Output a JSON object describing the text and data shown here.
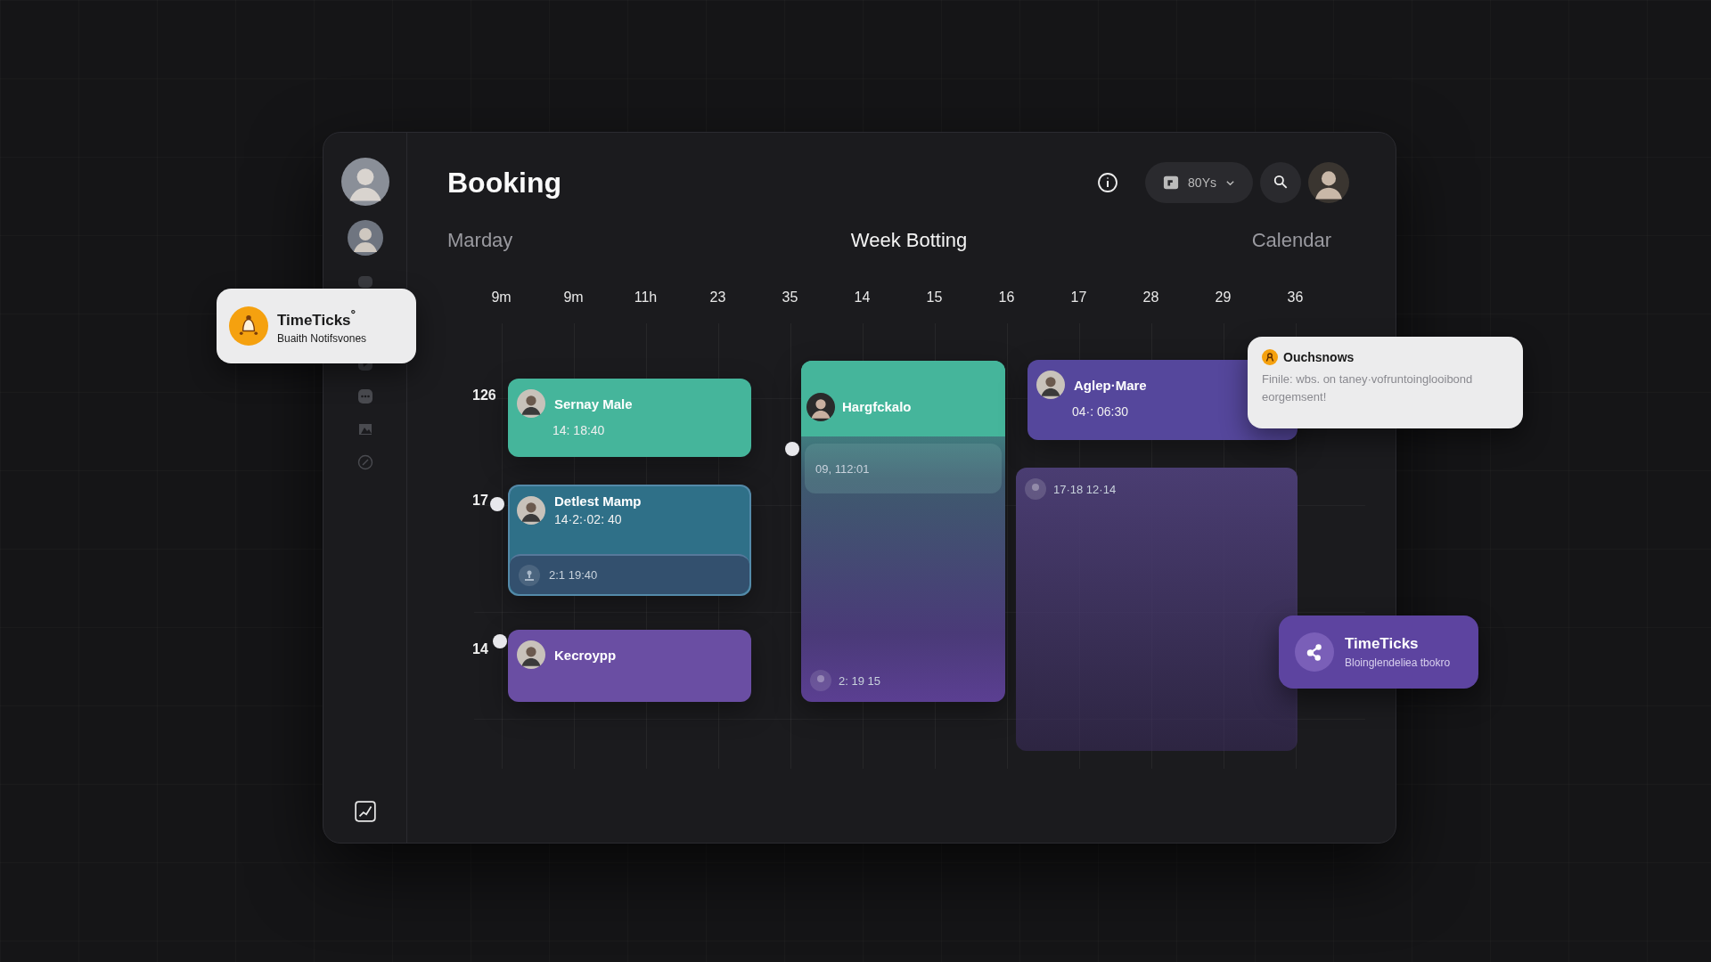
{
  "header": {
    "title": "Booking",
    "dropdown": {
      "value": "80Ys"
    }
  },
  "view_bar": {
    "left": "Marday",
    "center": "Week Botting",
    "right": "Calendar"
  },
  "hours": [
    "9m",
    "9m",
    "11h",
    "23",
    "35",
    "14",
    "15",
    "16",
    "17",
    "28",
    "29",
    "36"
  ],
  "rows": [
    "126",
    "17",
    "14"
  ],
  "events": [
    {
      "kind": "card",
      "title": "Sernay Male",
      "time": "14: 18:40",
      "color": "#45b59b"
    },
    {
      "kind": "split",
      "title": "Detlest Mamp",
      "time": "14·2:·02: 40",
      "detail": "2:1 19:40",
      "color": "#2f7088"
    },
    {
      "kind": "card",
      "title": "Kecroypp",
      "color": "#6a4ea3"
    },
    {
      "kind": "column",
      "title": "Hargfckalo",
      "detail": "09, 112:01",
      "footer": "2: 19 15",
      "color": "#45b59b"
    },
    {
      "kind": "card",
      "title": "Aglep·Mare",
      "time": "04·: 06:30",
      "color": "#55479c"
    },
    {
      "kind": "block",
      "time": "17·18 12·14",
      "color": "#4a3d72"
    }
  ],
  "notifications": [
    {
      "kind": "app",
      "title": "TimeTicks$^{°}$",
      "body": "Buaith Notifsvones"
    },
    {
      "kind": "banner",
      "title": "Ouchsnows",
      "body": "Finile: wbs. on taney·vofruntoinglooibond eorgemsent!"
    },
    {
      "kind": "accent",
      "title": "TimeTicks",
      "body": "Bloinglendeliea tbokro"
    }
  ]
}
